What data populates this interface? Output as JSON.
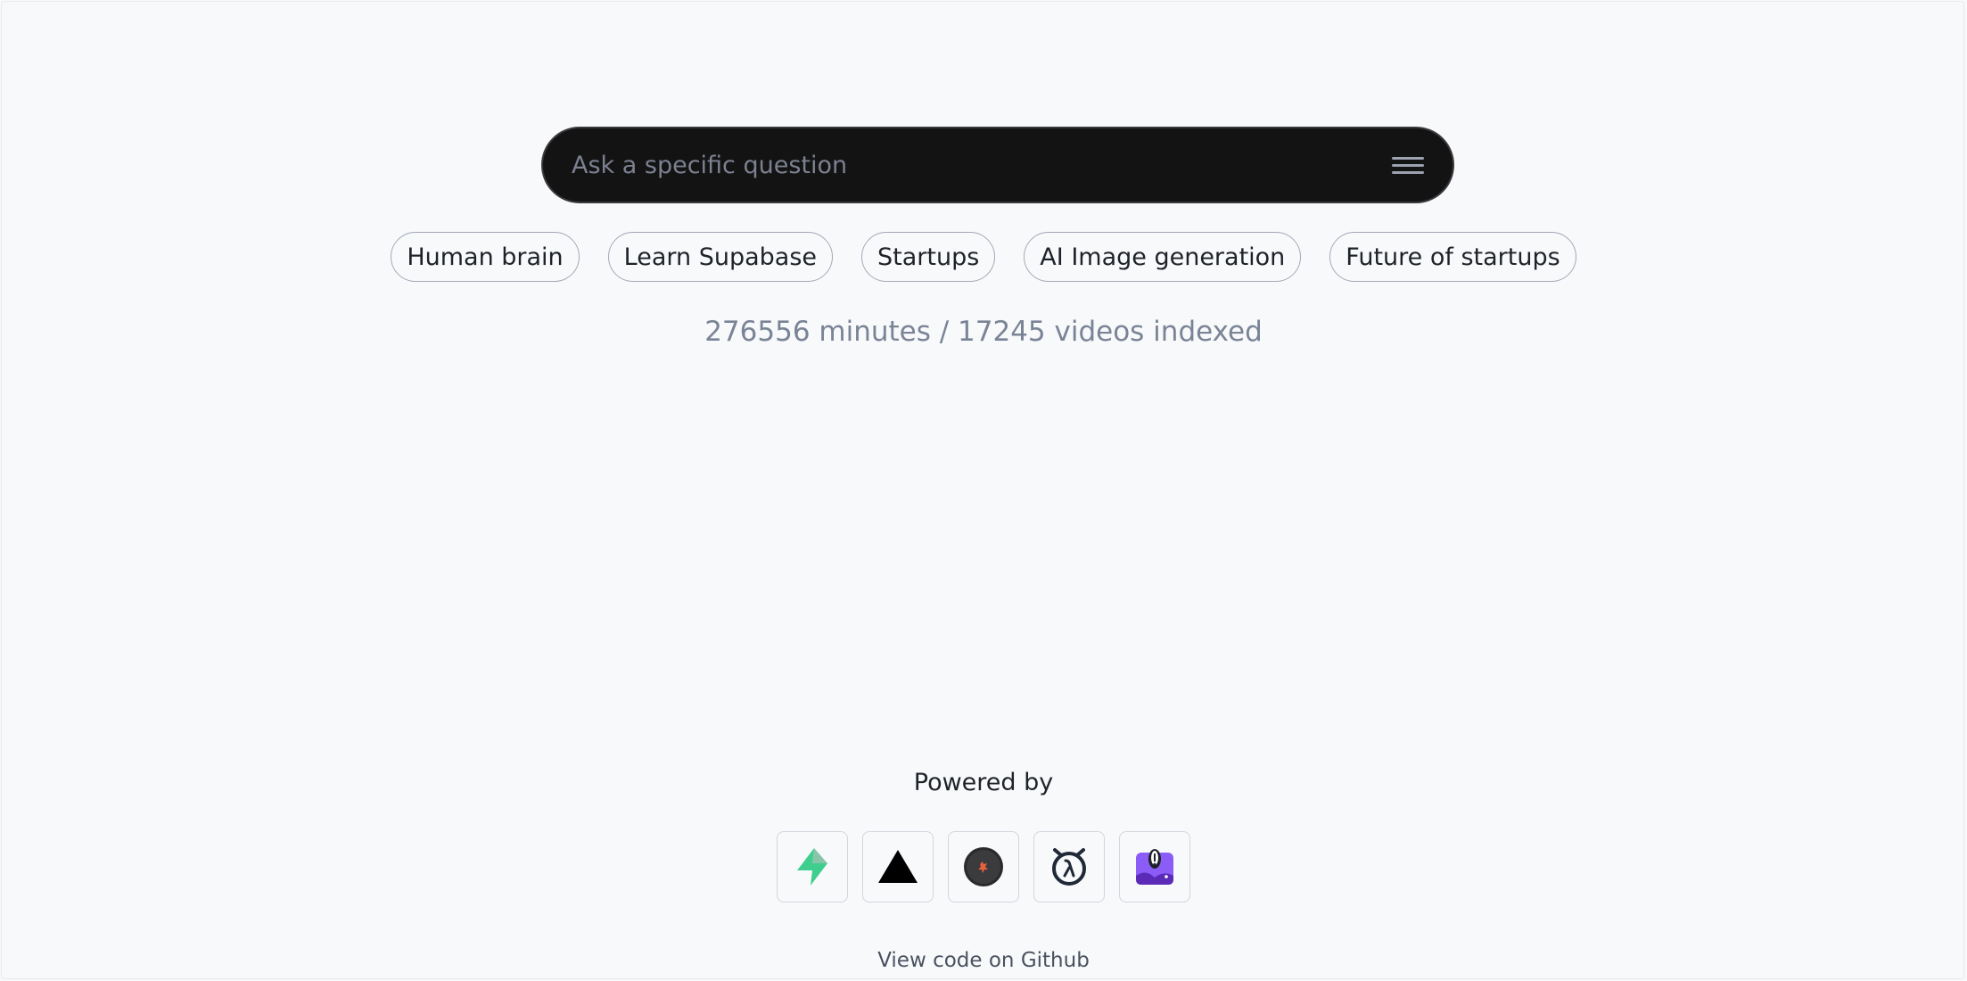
{
  "search": {
    "placeholder": "Ask a specific question",
    "value": ""
  },
  "menu_icon": "menu-icon",
  "suggestions": [
    {
      "label": "Human brain"
    },
    {
      "label": "Learn Supabase"
    },
    {
      "label": "Startups"
    },
    {
      "label": "AI Image generation"
    },
    {
      "label": "Future of startups"
    }
  ],
  "stats": {
    "text": "276556 minutes / 17245 videos indexed"
  },
  "powered_by": {
    "label": "Powered by",
    "logos": [
      {
        "icon": "supabase-logo-icon",
        "color": "#3ecf8e"
      },
      {
        "icon": "vercel-logo-icon",
        "color": "#000000"
      },
      {
        "icon": "replicate-logo-icon",
        "color": "#e8613c"
      },
      {
        "icon": "lambda-logo-icon",
        "color": "#1f2937"
      },
      {
        "icon": "purple-brand-logo-icon",
        "color": "#8b5cf6"
      }
    ]
  },
  "footer": {
    "github_label": "View code on Github"
  },
  "colors": {
    "background": "#f8f9fb",
    "search_background": "#141314",
    "muted_text": "#7a8496"
  }
}
